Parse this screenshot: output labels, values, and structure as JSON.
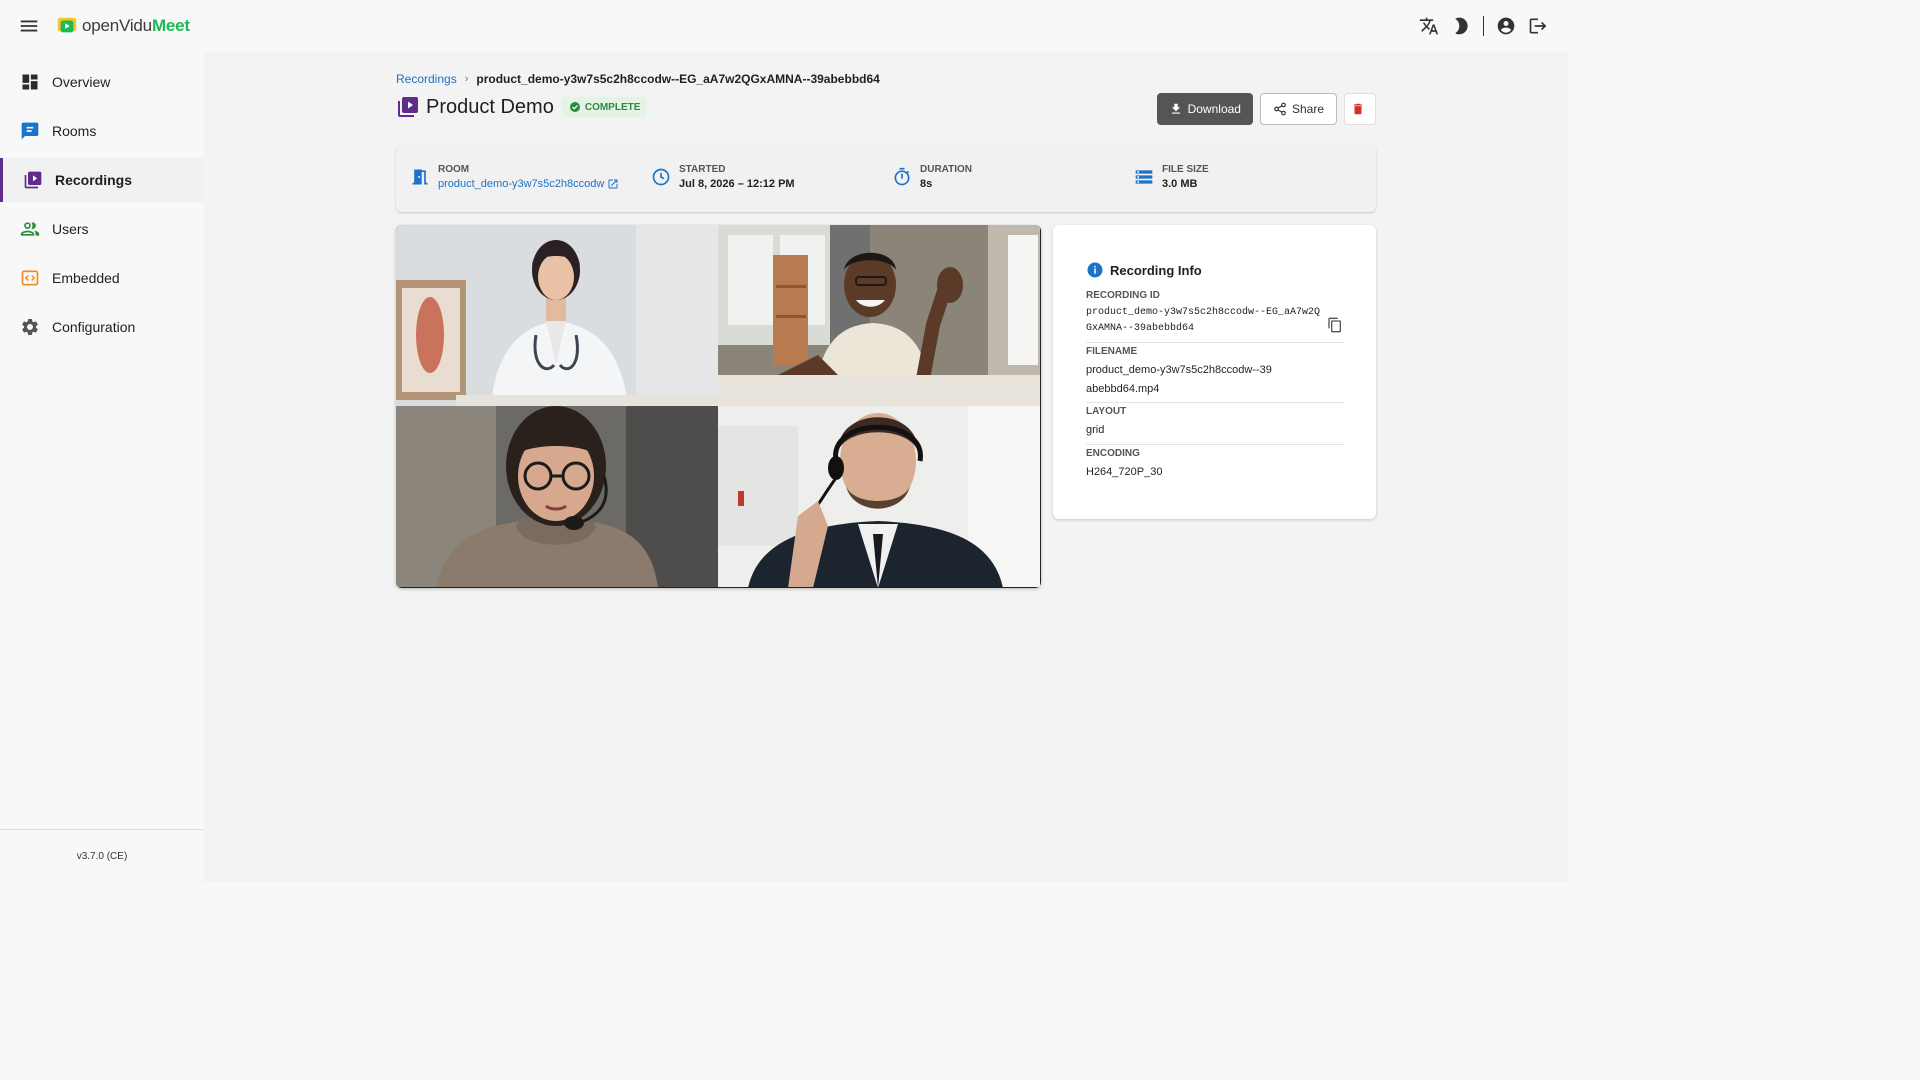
{
  "app": {
    "logo_text_a": "openVidu",
    "logo_text_b": "Meet"
  },
  "sidebar": {
    "items": [
      {
        "label": "Overview"
      },
      {
        "label": "Rooms"
      },
      {
        "label": "Recordings"
      },
      {
        "label": "Users"
      },
      {
        "label": "Embedded"
      },
      {
        "label": "Configuration"
      }
    ],
    "version": "v3.7.0 (CE)"
  },
  "breadcrumb": {
    "parent": "Recordings",
    "current": "product_demo-y3w7s5c2h8ccodw--EG_aA7w2QGxAMNA--39abebbd64"
  },
  "header": {
    "title": "Product Demo",
    "status": "COMPLETE"
  },
  "actions": {
    "download": "Download",
    "share": "Share"
  },
  "infobar": {
    "room_label": "ROOM",
    "room_value": "product_demo-y3w7s5c2h8ccodw",
    "started_label": "STARTED",
    "started_value": "Jul 8, 2026 – 12:12 PM",
    "duration_label": "DURATION",
    "duration_value": "8s",
    "size_label": "FILE SIZE",
    "size_value": "3.0 MB"
  },
  "recording_info": {
    "title": "Recording Info",
    "id_label": "RECORDING ID",
    "id_value": "product_demo-y3w7s5c2h8ccodw--EG_aA7w2QGxAMNA--39abebbd64",
    "filename_label": "FILENAME",
    "filename_value": "product_demo-y3w7s5c2h8ccodw--39abebbd64.mp4",
    "layout_label": "LAYOUT",
    "layout_value": "grid",
    "encoding_label": "ENCODING",
    "encoding_value": "H264_720P_30"
  },
  "colors": {
    "accent": "#5f2c8c",
    "link": "#1a73c8",
    "success": "#2e8b3e",
    "danger": "#d32f2f"
  }
}
